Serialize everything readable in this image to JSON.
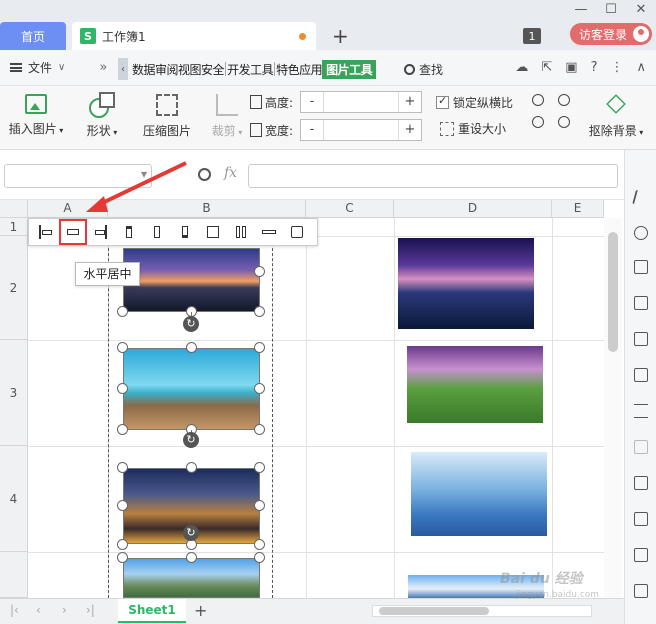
{
  "titlebar": {
    "home_tab": "首页",
    "doc_tab": "工作簿1",
    "doc_icon": "S",
    "add_tab": "+",
    "badge": "1",
    "visitor_login": "访客登录"
  },
  "menubar": {
    "file": "文件",
    "more": "»",
    "tabs": [
      "数据",
      "审阅",
      "视图",
      "安全",
      "开发工具",
      "特色应用",
      "图片工具"
    ],
    "find": "查找"
  },
  "ribbon": {
    "insert_picture": "插入图片",
    "shape": "形状",
    "compress": "压缩图片",
    "crop": "裁剪",
    "height_label": "高度:",
    "width_label": "宽度:",
    "height_value": "",
    "width_value": "",
    "minus": "-",
    "plus": "+",
    "lock_ratio": "锁定纵横比",
    "reset_size": "重设大小",
    "remove_bg": "抠除背景"
  },
  "formula": {
    "name_box": "",
    "fx": "fx",
    "input": ""
  },
  "sheet": {
    "columns": [
      "A",
      "B",
      "C",
      "D",
      "E"
    ],
    "rows": [
      "1",
      "2",
      "3",
      "4"
    ]
  },
  "align_toolbar": {
    "tooltip": "水平居中"
  },
  "bottom": {
    "sheet_tab": "Sheet1",
    "add_sheet": "+"
  },
  "watermark": {
    "brand": "Bai du 经验",
    "url": "jingyan.baidu.com"
  },
  "colors": {
    "accent_green": "#3aa35a",
    "home_tab_blue": "#6d8ef2",
    "visitor_red": "#e26b6b",
    "highlight_red": "#e53935"
  }
}
